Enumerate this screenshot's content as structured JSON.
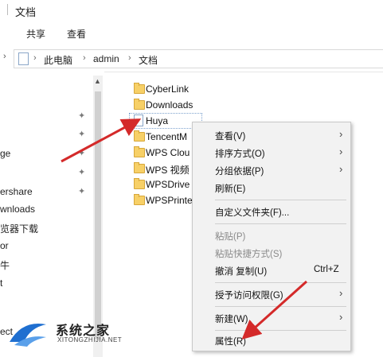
{
  "window": {
    "title": "文档"
  },
  "ribbon": {
    "tabs": [
      "共享",
      "查看"
    ]
  },
  "address": {
    "crumbs": [
      "此电脑",
      "admin",
      "文档"
    ]
  },
  "nav": {
    "items": [
      "ge",
      "ershare",
      "wnloads",
      "览器下载",
      "or",
      "牛",
      "t",
      "ect"
    ]
  },
  "files": [
    {
      "label": "CyberLink",
      "kind": "folder"
    },
    {
      "label": "Downloads",
      "kind": "folder"
    },
    {
      "label": "Huya",
      "kind": "file",
      "selected": true
    },
    {
      "label": "TencentM",
      "kind": "folder"
    },
    {
      "label": "WPS Clou",
      "kind": "folder"
    },
    {
      "label": "WPS 视频",
      "kind": "folder"
    },
    {
      "label": "WPSDrive",
      "kind": "folder"
    },
    {
      "label": "WPSPrinte",
      "kind": "folder"
    }
  ],
  "context_menu": {
    "items": [
      {
        "label": "查看(V)",
        "submenu": true
      },
      {
        "label": "排序方式(O)",
        "submenu": true
      },
      {
        "label": "分组依据(P)",
        "submenu": true
      },
      {
        "label": "刷新(E)"
      },
      {
        "label": "自定义文件夹(F)..."
      },
      {
        "label": "粘贴(P)",
        "disabled": true
      },
      {
        "label": "粘贴快捷方式(S)",
        "disabled": true
      },
      {
        "label": "撤消 复制(U)",
        "shortcut": "Ctrl+Z"
      },
      {
        "label": "授予访问权限(G)",
        "submenu": true
      },
      {
        "label": "新建(W)",
        "submenu": true
      },
      {
        "label": "属性(R)"
      }
    ]
  },
  "watermark": {
    "title": "系统之家",
    "url": "XITONGZHIJIA.NET"
  },
  "colors": {
    "annotation_arrow": "#d42a2a",
    "folder": "#f7d067",
    "menu_bg": "#f2f2f2"
  }
}
